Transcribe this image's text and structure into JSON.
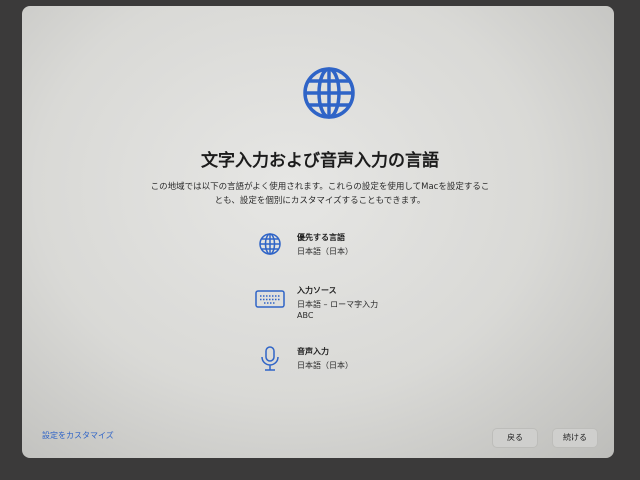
{
  "title": "文字入力および音声入力の言語",
  "description": "この地域では以下の言語がよく使用されます。これらの設定を使用してMacを設定することも、設定を個別にカスタマイズすることもできます。",
  "items": [
    {
      "label": "優先する言語",
      "values": [
        "日本語（日本）"
      ]
    },
    {
      "label": "入力ソース",
      "values": [
        "日本語 – ローマ字入力",
        "ABC"
      ]
    },
    {
      "label": "音声入力",
      "values": [
        "日本語（日本）"
      ]
    }
  ],
  "footer": {
    "customize": "設定をカスタマイズ",
    "back": "戻る",
    "continue": "続ける"
  },
  "accent": "#2f64c7"
}
